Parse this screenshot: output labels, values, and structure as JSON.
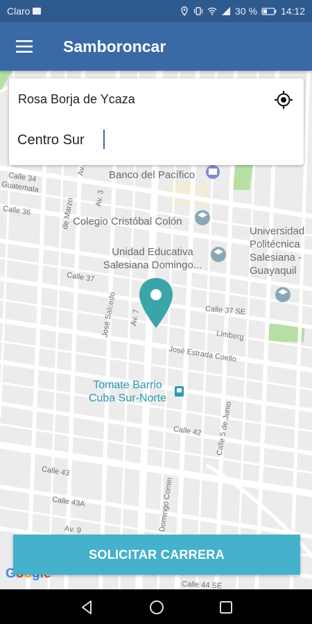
{
  "status_bar": {
    "carrier": "Claro",
    "battery": "30 %",
    "time": "14:12"
  },
  "app_bar": {
    "title": "Samboroncar",
    "menu_icon": "hamburger-menu-icon"
  },
  "search": {
    "origin": "Rosa Borja de Ycaza",
    "destination_value": "Centro Sur",
    "locate_icon": "my-location-icon"
  },
  "map": {
    "pois": {
      "bank": "Banco del Pacífico",
      "colegio": "Colegio Cristóbal Colón",
      "unidad_line1": "Unidad Educativa",
      "unidad_line2": "Salesiana Domingo...",
      "uni_line1": "Universidad",
      "uni_line2": "Politécnica",
      "uni_line3": "Salesiana -",
      "uni_line4": "Guayaquil",
      "tomate_line1": "Tomate Barrio",
      "tomate_line2": "Cuba Sur-Norte"
    },
    "streets": {
      "calle34": "Calle 34",
      "guatemala": "Guatemala",
      "calle36": "Calle 36",
      "de_marzo": "de Marzo",
      "ay3": "Av. 3",
      "ay": "Av.",
      "calle37": "Calle 37",
      "jose_salcedo": "José Salcedo",
      "av7": "Av. 7",
      "calle37se": "Calle 37 SE",
      "limberg": "Limberg",
      "jose_estrada": "José Estrada Coello",
      "calle42": "Calle 42",
      "calle5junio": "Calle 5 de Junio",
      "calle43": "Calle 43",
      "calle43a": "Calle 43A",
      "av9": "Av. 9",
      "domingo_comin": "Domingo Comin",
      "calle44se": "Calle 44 SE"
    },
    "pin_icon": "location-pin-icon",
    "attribution": "Google"
  },
  "action": {
    "request_label": "SOLICITAR CARRERA"
  },
  "colors": {
    "status_bar": "#2f5a8e",
    "app_bar": "#3a6aa6",
    "button": "#45b1cd",
    "pin": "#3aa5a8"
  }
}
